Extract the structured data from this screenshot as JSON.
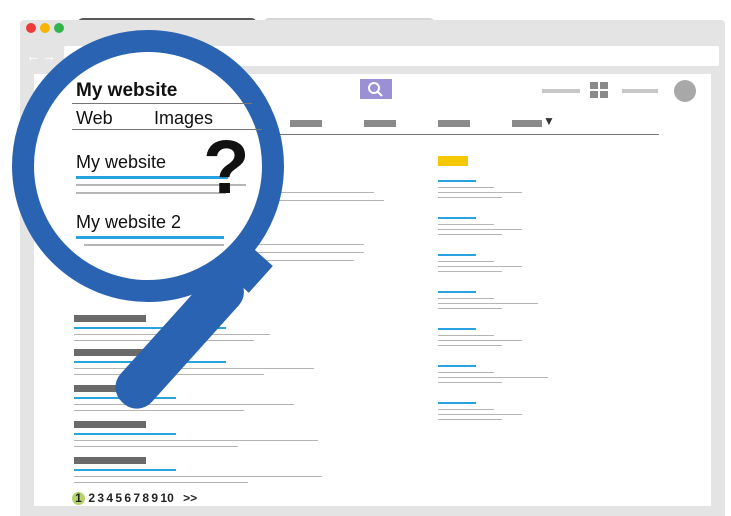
{
  "search": {
    "query": "My website"
  },
  "tabs": {
    "web_label": "Web",
    "images_label": "Images"
  },
  "results": [
    {
      "title": "My website"
    },
    {
      "title": "My website 2"
    }
  ],
  "question_mark": "?",
  "pagination": {
    "current": "1",
    "pages": "2 3 4 5 6 7 8 9 10",
    "next": ">>"
  },
  "colors": {
    "magnifier_blue": "#2a63b1",
    "link_blue": "#29a3e0",
    "ad_yellow": "#f6c800",
    "page_badge": "#b7d36b",
    "search_button": "#9b8fd6"
  },
  "icons": {
    "search_button": "search-icon",
    "nav": [
      "back-arrow-icon",
      "forward-arrow-icon"
    ],
    "toolbar": [
      "menu-line-icon",
      "apps-grid-icon",
      "menu-line-icon",
      "profile-circle-icon"
    ]
  }
}
